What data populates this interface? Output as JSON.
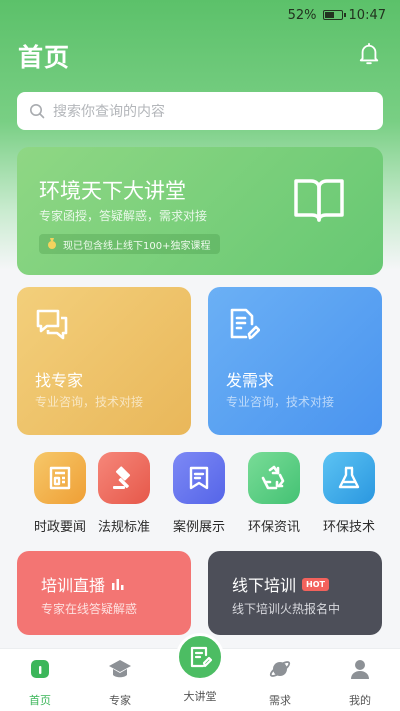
{
  "status_bar": {
    "battery": "52%",
    "time": "10:47"
  },
  "header": {
    "title": "首页"
  },
  "search": {
    "placeholder": "搜索你查询的内容"
  },
  "lecture_banner": {
    "title": "环境天下大讲堂",
    "subtitle": "专家函授，答疑解惑，需求对接",
    "chip": "现已包含线上线下100+独家课程"
  },
  "cards": [
    {
      "title": "找专家",
      "subtitle": "专业咨询，技术对接"
    },
    {
      "title": "发需求",
      "subtitle": "专业咨询，技术对接"
    }
  ],
  "grid": [
    {
      "label": "时政要闻",
      "icon": "newspaper-icon",
      "color": "#f0b24a"
    },
    {
      "label": "法规标准",
      "icon": "gavel-icon",
      "color": "#ef6b5a"
    },
    {
      "label": "案例展示",
      "icon": "bookmark-icon",
      "color": "#6a78f0"
    },
    {
      "label": "环保资讯",
      "icon": "recycle-icon",
      "color": "#5fcf84"
    },
    {
      "label": "环保技术",
      "icon": "flask-icon",
      "color": "#39a6e8"
    }
  ],
  "promos": [
    {
      "title": "培训直播",
      "subtitle": "专家在线答疑解惑"
    },
    {
      "title": "线下培训",
      "badge": "HOT",
      "subtitle": "线下培训火热报名中"
    }
  ],
  "tabbar": [
    {
      "label": "首页",
      "icon": "home-icon",
      "active": true
    },
    {
      "label": "专家",
      "icon": "graduation-cap-icon"
    },
    {
      "label": "大讲堂",
      "icon": "edit-note-icon"
    },
    {
      "label": "需求",
      "icon": "planet-icon"
    },
    {
      "label": "我的",
      "icon": "user-icon"
    }
  ],
  "colors": {
    "brand_green": "#5cc16a",
    "tab_active": "#3cb65a"
  }
}
